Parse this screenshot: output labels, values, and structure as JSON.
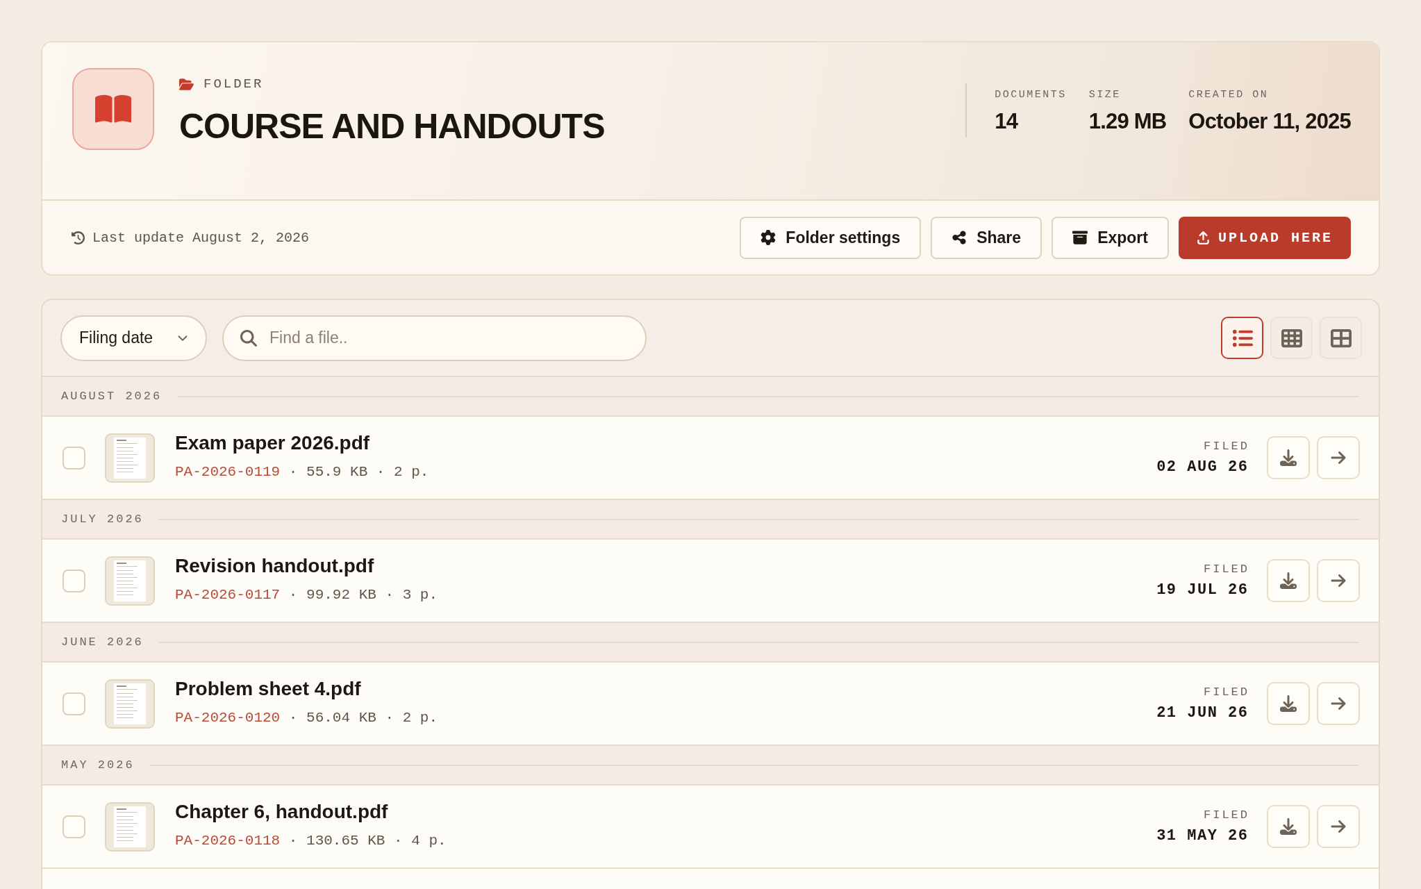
{
  "folder": {
    "eyebrow": "FOLDER",
    "title": "COURSE AND HANDOUTS"
  },
  "stats": [
    {
      "label": "DOCUMENTS",
      "value": "14"
    },
    {
      "label": "SIZE",
      "value": "1.29 MB"
    },
    {
      "label": "CREATED ON",
      "value": "October 11, 2025"
    }
  ],
  "last_update": "Last update August 2, 2026",
  "actions": [
    {
      "kind": "settings",
      "label": "Folder settings",
      "primary": false
    },
    {
      "kind": "share",
      "label": "Share",
      "primary": false
    },
    {
      "kind": "export",
      "label": "Export",
      "primary": false
    },
    {
      "kind": "upload",
      "label": "UPLOAD HERE",
      "primary": true
    }
  ],
  "sort_select": {
    "value": "Filing date"
  },
  "search": {
    "placeholder": "Find a file.."
  },
  "view_modes": [
    {
      "kind": "list",
      "selected": true
    },
    {
      "kind": "grid",
      "selected": false
    },
    {
      "kind": "tiles",
      "selected": false
    }
  ],
  "groups": [
    {
      "heading": "AUGUST 2026",
      "files": [
        {
          "name": "Exam paper 2026.pdf",
          "reference": "PA-2026-0119",
          "details": "· 55.9 KB · 2 p.",
          "filed_label": "FILED",
          "filed_date": "02 AUG 26",
          "checked": false
        }
      ]
    },
    {
      "heading": "JULY 2026",
      "files": [
        {
          "name": "Revision handout.pdf",
          "reference": "PA-2026-0117",
          "details": "· 99.92 KB · 3 p.",
          "filed_label": "FILED",
          "filed_date": "19 JUL 26",
          "checked": false
        }
      ]
    },
    {
      "heading": "JUNE 2026",
      "files": [
        {
          "name": "Problem sheet 4.pdf",
          "reference": "PA-2026-0120",
          "details": "· 56.04 KB · 2 p.",
          "filed_label": "FILED",
          "filed_date": "21 JUN 26",
          "checked": false
        }
      ]
    },
    {
      "heading": "MAY 2026",
      "files": [
        {
          "name": "Chapter 6, handout.pdf",
          "reference": "PA-2026-0118",
          "details": "· 130.65 KB · 4 p.",
          "filed_label": "FILED",
          "filed_date": "31 MAY 26",
          "checked": false
        }
      ]
    }
  ]
}
